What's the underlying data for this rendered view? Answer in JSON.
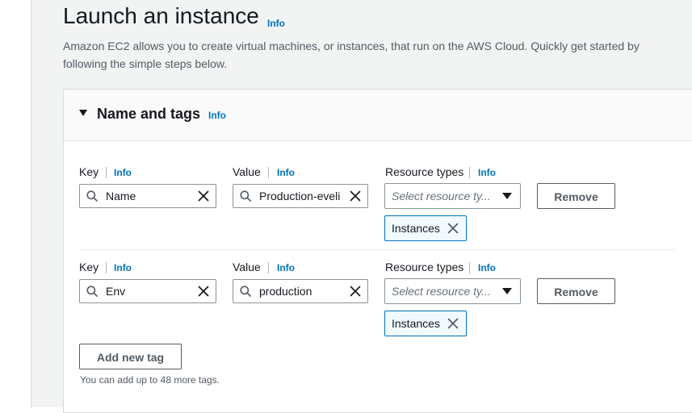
{
  "page": {
    "title": "Launch an instance",
    "title_info": "Info",
    "description": "Amazon EC2 allows you to create virtual machines, or instances, that run on the AWS Cloud. Quickly get started by following the simple steps below."
  },
  "section": {
    "title": "Name and tags",
    "info": "Info",
    "expanded": true
  },
  "labels": {
    "key": "Key",
    "value": "Value",
    "resource_types": "Resource types",
    "info": "Info"
  },
  "tags": [
    {
      "key": "Name",
      "value": "Production-eveli",
      "resource_placeholder": "Select resource ty...",
      "remove_label": "Remove",
      "token": "Instances"
    },
    {
      "key": "Env",
      "value": "production",
      "resource_placeholder": "Select resource ty...",
      "remove_label": "Remove",
      "token": "Instances"
    }
  ],
  "add_tag_label": "Add new tag",
  "hint": "You can add up to 48 more tags.",
  "icons": {
    "search": "search-icon",
    "clear": "close-icon",
    "dropdown": "caret-down-icon",
    "token_remove": "close-icon",
    "collapse": "caret-down-icon"
  },
  "colors": {
    "link": "#0073bb",
    "text": "#16191f",
    "secondary_text": "#545b64",
    "border": "#879596",
    "token_border": "#0073bb",
    "token_bg": "#f1faff",
    "page_bg": "#f2f3f3"
  }
}
